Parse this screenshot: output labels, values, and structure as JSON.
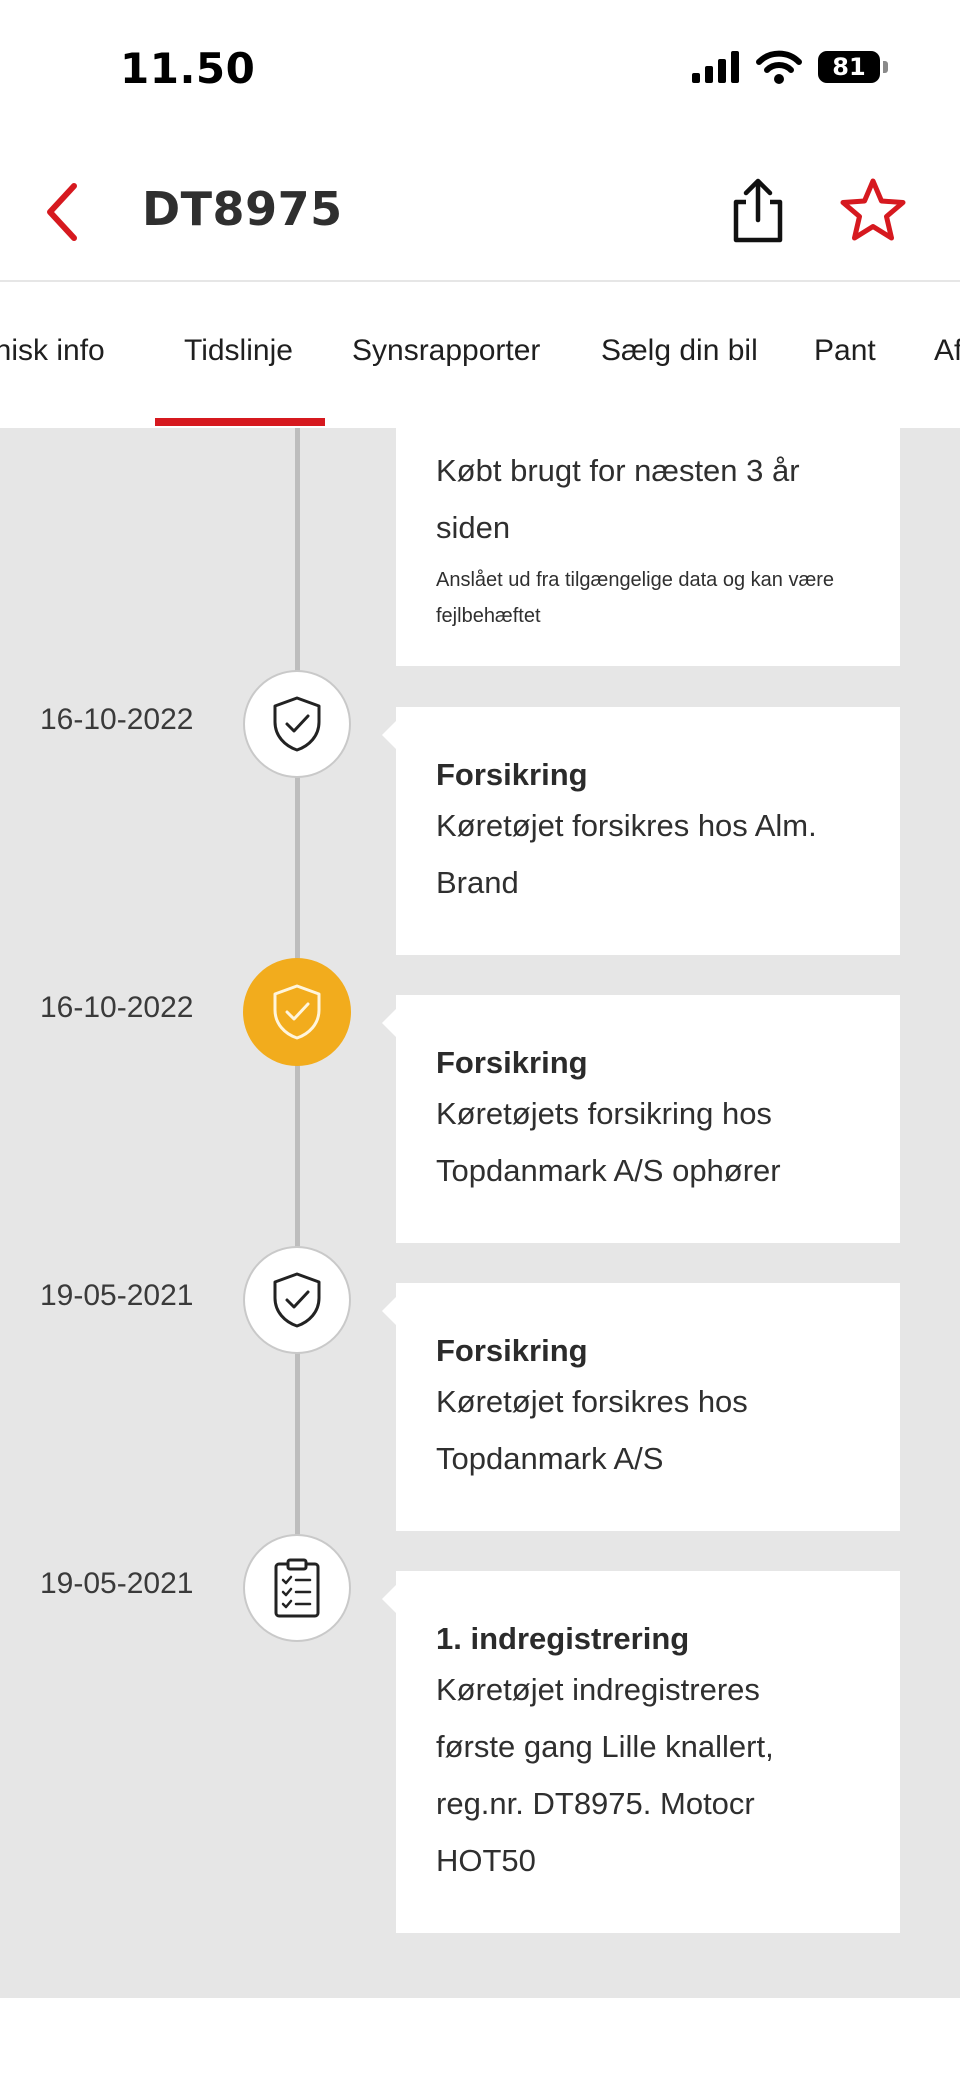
{
  "status_bar": {
    "time": "11.50",
    "battery": "81"
  },
  "header": {
    "title": "DT8975"
  },
  "tabs": [
    {
      "label": "Teknisk info"
    },
    {
      "label": "Tidslinje"
    },
    {
      "label": "Synsrapporter"
    },
    {
      "label": "Sælg din bil"
    },
    {
      "label": "Pant"
    },
    {
      "label": "Af"
    }
  ],
  "active_tab": "Tidslinje",
  "colors": {
    "accent": "#d6191f",
    "active_node": "#f2ac1d",
    "timeline_bg": "#e6e6e6"
  },
  "timeline": {
    "top_card": {
      "text_line1": "Købt brugt for næsten 3 år",
      "text_line2": "siden",
      "note_line1": "Anslået ud fra tilgængelige data og kan være",
      "note_line2": "fejlbehæftet"
    },
    "events": [
      {
        "date": "16-10-2022",
        "icon": "shield-check-icon",
        "title": "Forsikring",
        "line1": "Køretøjet forsikres hos Alm.",
        "line2": "Brand"
      },
      {
        "date": "16-10-2022",
        "icon": "shield-check-icon",
        "title": "Forsikring",
        "line1": "Køretøjets forsikring hos",
        "line2": "Topdanmark A/S ophører"
      },
      {
        "date": "19-05-2021",
        "icon": "shield-check-icon",
        "title": "Forsikring",
        "line1": "Køretøjet forsikres hos",
        "line2": "Topdanmark A/S"
      },
      {
        "date": "19-05-2021",
        "icon": "clipboard-checklist-icon",
        "title": "1. indregistrering",
        "line1": "Køretøjet indregistreres",
        "line2": "første gang Lille knallert,",
        "line3": "reg.nr. DT8975. Motocr",
        "line4": "HOT50"
      }
    ]
  }
}
